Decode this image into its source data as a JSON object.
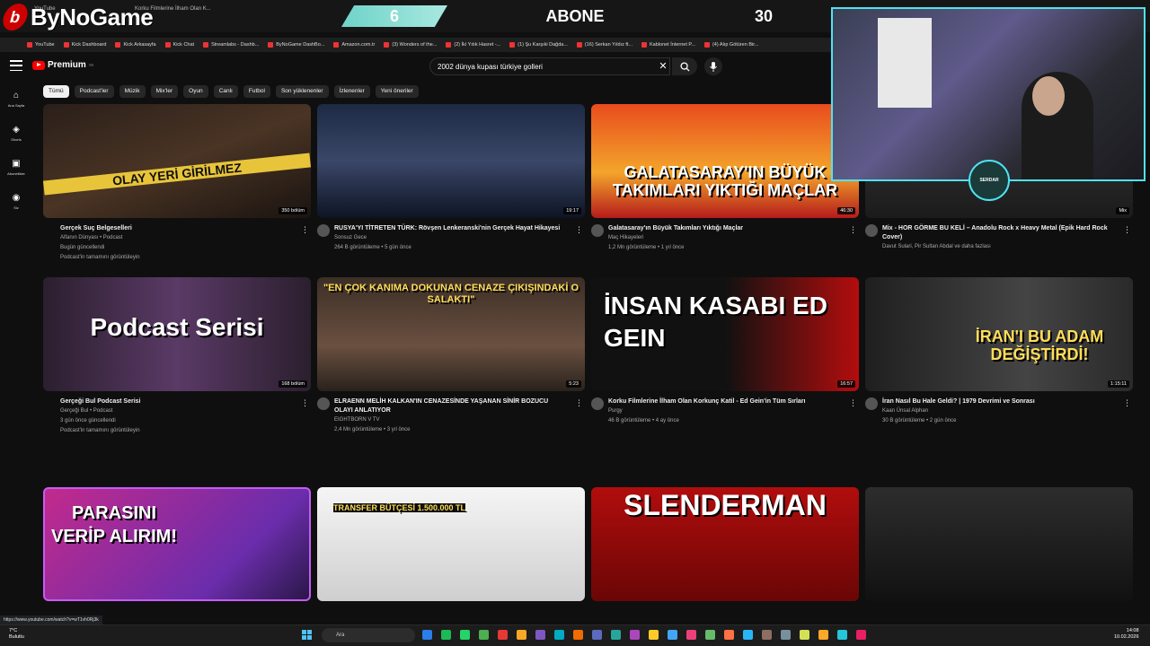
{
  "overlay": {
    "brand": "ByNoGame",
    "count_left": "6",
    "abone_label": "ABONE",
    "count_right": "30",
    "streamer_badge": "SERDAR"
  },
  "browser": {
    "tab_titles": [
      "YouTube",
      "Korku Filmlerine İlham Olan K..."
    ],
    "bookmarks": [
      "YouTube",
      "Kick Dashboard",
      "Kick Arkasayfa",
      "Kick Chat",
      "Streamlabs - Dashb...",
      "ByNoGame DashBo...",
      "Amazon.com.tr",
      "(3) Wonders of the...",
      "(2) İki Yıtık Hasret -...",
      "(1) Şu Karşıki Dağda...",
      "(16) Serkan Yıldız ft...",
      "Kablonet İnternet P...",
      "(4) Alıp Götüren Bir..."
    ],
    "status_url": "https://www.youtube.com/watch?v=wT1vh0Rj3k"
  },
  "youtube": {
    "brand": "Premium",
    "brand_sup": "TR",
    "search_value": "2002 dünya kupası türkiye golleri",
    "chips": [
      "Tümü",
      "Podcast'ler",
      "Müzik",
      "Mix'ler",
      "Oyun",
      "Canlı",
      "Futbol",
      "Son yüklenenler",
      "İzlenenler",
      "Yeni öneriler"
    ],
    "sidebar": [
      {
        "label": "Ana Sayfa",
        "icon": "home-icon",
        "glyph": "⌂"
      },
      {
        "label": "Shorts",
        "icon": "shorts-icon",
        "glyph": "◈"
      },
      {
        "label": "Abonelikler",
        "icon": "subscriptions-icon",
        "glyph": "▣"
      },
      {
        "label": "Siz",
        "icon": "you-icon",
        "glyph": "◉"
      }
    ],
    "videos": [
      {
        "thumb_text": "OLAY YERİ GİRİLMEZ",
        "badge": "350 bölüm",
        "title": "Gerçek Suç Belgeselleri",
        "channel": "Alfanın Dünyası • Podcast",
        "line2": "Bugün güncellendi",
        "line3": "Podcast'in tamamını görüntüleyin"
      },
      {
        "thumb_text": "",
        "badge": "19:17",
        "title": "RUSYA'YI TİTRETEN TÜRK: Rövşen Lenkeranski'nin Gerçek Hayat Hikayesi",
        "channel": "Sonsuz Gece",
        "line2": "264 B görüntüleme • 5 gün önce",
        "line3": ""
      },
      {
        "thumb_text": "GALATASARAY'IN BÜYÜK TAKIMLARI YIKTIĞI MAÇLAR",
        "badge": "46:30",
        "title": "Galatasaray'ın Büyük Takımları Yıktığı Maçlar",
        "channel": "Maç Hikayeleri",
        "line2": "1,2 Mn görüntüleme • 1 yıl önce",
        "line3": ""
      },
      {
        "thumb_text": "",
        "badge": "Mix",
        "title": "Mix - HOR GÖRME BU KELİ – Anadolu Rock x Heavy Metal (Epik Hard Rock Cover)",
        "channel": "Davut Sulari, Pir Sultan Abdal ve daha fazlası",
        "line2": "",
        "line3": ""
      },
      {
        "thumb_text": "Podcast Serisi",
        "badge": "168 bölüm",
        "title": "Gerçeği Bul Podcast Serisi",
        "channel": "Gerçeği Bul • Podcast",
        "line2": "3 gün önce güncellendi",
        "line3": "Podcast'in tamamını görüntüleyin"
      },
      {
        "thumb_text": "\"EN ÇOK KANIMA DOKUNAN CENAZE ÇIKIŞINDAKİ O SALAKTI\"",
        "badge": "5:23",
        "title": "ELRAENN MELİH KALKAN'IN CENAZESİNDE YAŞANAN SİNİR BOZUCU OLAYI ANLATIYOR",
        "channel": "EIGHTBORN V TV",
        "line2": "2,4 Mn görüntüleme • 3 yıl önce",
        "line3": ""
      },
      {
        "thumb_text": "İNSAN KASABI ED GEIN",
        "badge": "16:57",
        "title": "Korku Filmlerine İlham Olan Korkunç Katil - Ed Gein'in Tüm Sırları",
        "channel": "Purgy",
        "line2": "46 B görüntüleme • 4 ay önce",
        "line3": ""
      },
      {
        "thumb_text": "İRAN'I BU ADAM DEĞİŞTİRDİ!",
        "badge": "1:15:11",
        "title": "İran Nasıl Bu Hale Geldi? | 1979 Devrimi ve Sonrası",
        "channel": "Kaan Ünsal Alphan",
        "line2": "30 B görüntüleme • 2 gün önce",
        "line3": ""
      },
      {
        "thumb_text": "PARASINI VERİP ALIRIM!",
        "badge": "",
        "title": "",
        "channel": "",
        "line2": "",
        "line3": ""
      },
      {
        "thumb_text": "TRANSFER BÜTÇESİ 1.500.000 TL",
        "badge": "",
        "title": "",
        "channel": "",
        "line2": "",
        "line3": ""
      },
      {
        "thumb_text": "SLENDERMAN",
        "badge": "",
        "title": "",
        "channel": "",
        "line2": "",
        "line3": ""
      },
      {
        "thumb_text": "",
        "badge": "",
        "title": "",
        "channel": "",
        "line2": "",
        "line3": ""
      }
    ]
  },
  "taskbar": {
    "weather_temp": "7°C",
    "weather_desc": "Bulutlu",
    "search_placeholder": "Ara",
    "time": "14:08",
    "date": "10.02.2026"
  },
  "colors": {
    "accent_cyan": "#4fe3f1",
    "yt_red": "#ff0000"
  }
}
